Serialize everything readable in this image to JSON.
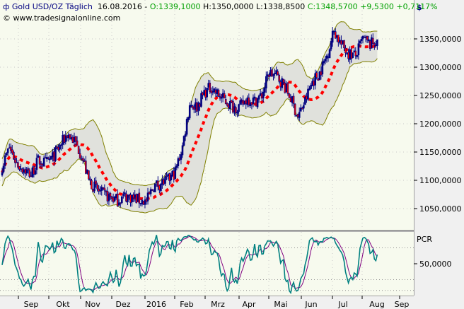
{
  "header": {
    "symbol_icon": "bar-chart-icon",
    "title": "Gold USD/OZ Täglich",
    "date": "16.08.2016",
    "sep": "-",
    "open": "O:1339,1000",
    "high": "H:1350,0000",
    "low": "L:1338,8500",
    "close": "C:1348,5700",
    "change": "+9,5300",
    "change_pct": "+0,7117%",
    "copyright": "© www.tradesignalonline.com"
  },
  "colors": {
    "background": "#f7faee",
    "band_fill": "#e0e1dc",
    "band_line": "#808000",
    "candle": "#000080",
    "candle_down_body": "#ff0000",
    "ma": "#ff0000",
    "pcr": "#008080",
    "pcr_signal": "#800080",
    "positive": "#00a000"
  },
  "chart_data": [
    {
      "type": "line",
      "title": "Gold USD/OZ Täglich",
      "currency_label": "$",
      "x_tick_labels": [
        "Sep",
        "Okt",
        "Nov",
        "Dez",
        "2016",
        "Feb",
        "Mrz",
        "Apr",
        "Mai",
        "Jun",
        "Jul",
        "Aug",
        "Sep"
      ],
      "y_tick_labels": [
        "1350,0000",
        "1300,0000",
        "1250,0000",
        "1200,0000",
        "1150,0000",
        "1100,0000",
        "1050,0000"
      ],
      "y_ticks": [
        1350,
        1300,
        1250,
        1200,
        1150,
        1100,
        1050
      ],
      "ylim": [
        1020,
        1385
      ],
      "weekly_close": [
        1125,
        1158,
        1130,
        1120,
        1110,
        1135,
        1130,
        1140,
        1160,
        1182,
        1170,
        1145,
        1100,
        1085,
        1075,
        1070,
        1065,
        1072,
        1070,
        1065,
        1062,
        1090,
        1095,
        1100,
        1115,
        1160,
        1235,
        1230,
        1255,
        1265,
        1250,
        1240,
        1230,
        1230,
        1245,
        1240,
        1250,
        1290,
        1285,
        1270,
        1245,
        1212,
        1240,
        1275,
        1290,
        1320,
        1365,
        1340,
        1325,
        1320,
        1350,
        1340,
        1348
      ],
      "grid": true
    },
    {
      "type": "line",
      "title": "PCR",
      "y_tick_labels": [
        "50,0000"
      ],
      "y_ticks": [
        50
      ],
      "ylim": [
        0,
        100
      ],
      "grid": true
    }
  ]
}
